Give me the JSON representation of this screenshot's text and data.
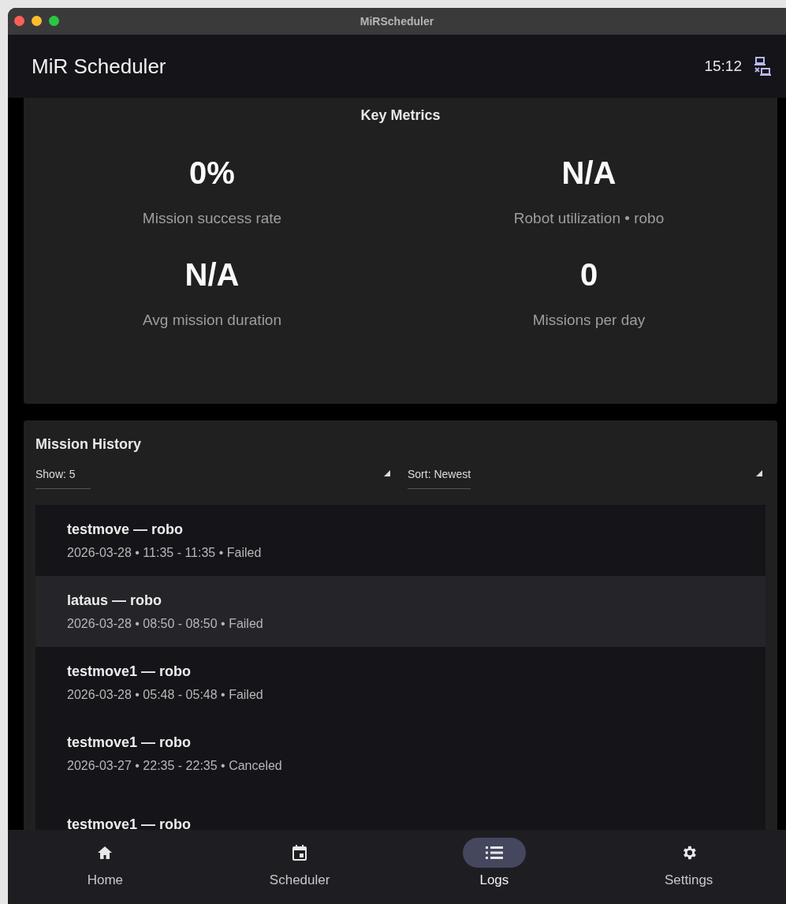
{
  "window": {
    "title": "MiRScheduler"
  },
  "header": {
    "title": "MiR Scheduler",
    "time": "15:12"
  },
  "key_metrics": {
    "title": "Key Metrics",
    "metrics": [
      {
        "value": "0%",
        "label": "Mission success rate"
      },
      {
        "value": "N/A",
        "label": "Robot utilization • robo"
      },
      {
        "value": "N/A",
        "label": "Avg mission duration"
      },
      {
        "value": "0",
        "label": "Missions per day"
      }
    ]
  },
  "mission_history": {
    "title": "Mission History",
    "show": "Show: 5",
    "sort": "Sort: Newest",
    "missions": [
      {
        "title": "testmove — robo",
        "detail": "2026-03-28 • 11:35 - 11:35 • Failed",
        "selected": false
      },
      {
        "title": "lataus — robo",
        "detail": "2026-03-28 • 08:50 - 08:50 • Failed",
        "selected": true
      },
      {
        "title": "testmove1 — robo",
        "detail": "2026-03-28 • 05:48 - 05:48 • Failed",
        "selected": false
      },
      {
        "title": "testmove1 — robo",
        "detail": "2026-03-27 • 22:35 - 22:35 • Canceled",
        "selected": false
      },
      {
        "title": "testmove1 — robo",
        "selected": false
      }
    ]
  },
  "nav": [
    {
      "label": "Home",
      "kind": "home",
      "selected": false
    },
    {
      "label": "Scheduler",
      "kind": "calendar",
      "selected": false
    },
    {
      "label": "Logs",
      "kind": "list",
      "selected": true
    },
    {
      "label": "Settings",
      "kind": "settings",
      "selected": false
    }
  ]
}
